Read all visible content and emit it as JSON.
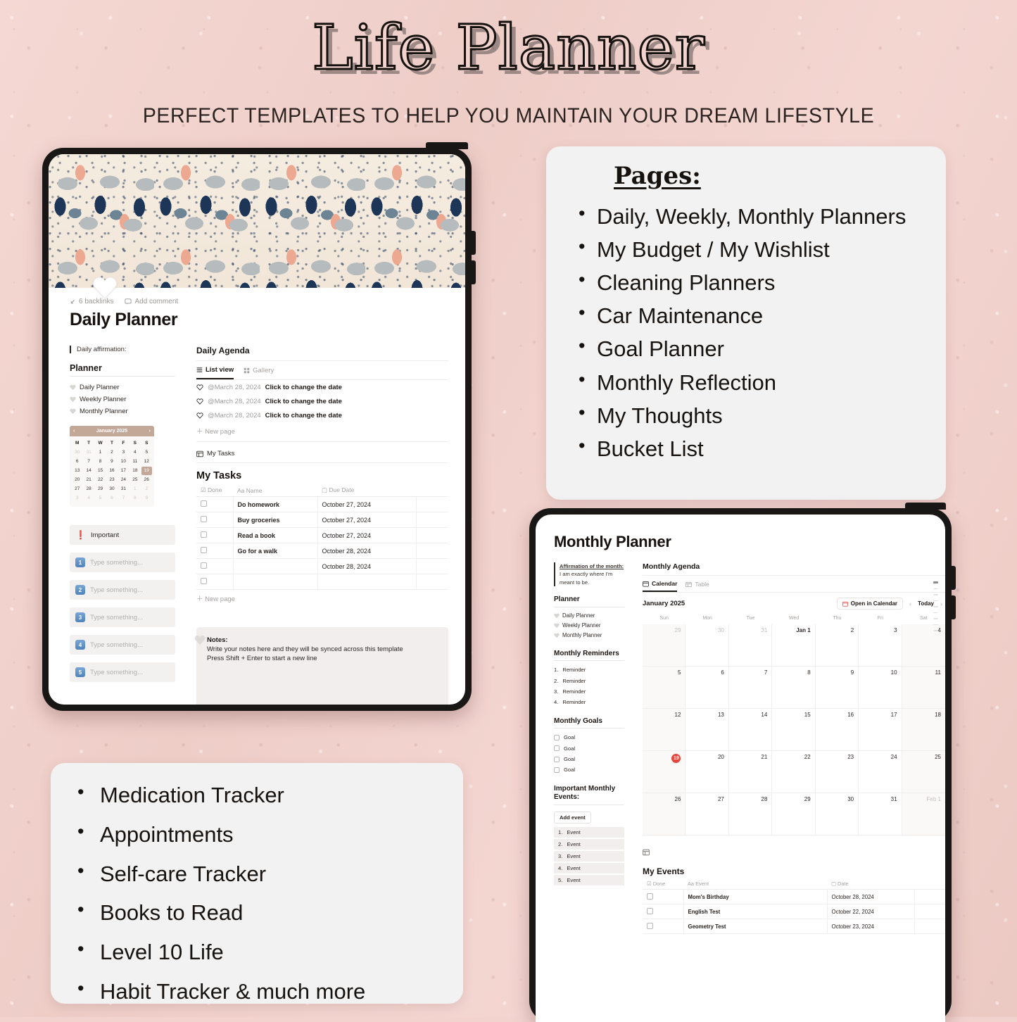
{
  "header": {
    "title": "Life Planner",
    "subtitle": "PERFECT TEMPLATES TO HELP YOU MAINTAIN YOUR DREAM LIFESTYLE"
  },
  "colors": {
    "background_pink": "#f2d3ce",
    "card_gray": "#f2f2f2",
    "tablet_bezel": "#191616",
    "calendar_accent": "#c3a898",
    "today_red": "#e8453c",
    "important_red": "#e03131",
    "number_blue": "#5b8ec4"
  },
  "pages_card": {
    "title": "Pages:",
    "items": [
      "Daily, Weekly, Monthly Planners",
      "My Budget / My Wishlist",
      "Cleaning Planners",
      "Car Maintenance",
      "Goal Planner",
      "Monthly Reflection",
      "My Thoughts",
      "Bucket List"
    ]
  },
  "features_card": {
    "items": [
      "Medication Tracker",
      "Appointments",
      "Self-care Tracker",
      "Books to Read",
      " Level 10 Life",
      " Habit Tracker & much more"
    ]
  },
  "daily_planner": {
    "meta": {
      "backlinks": "6 backlinks",
      "add_comment": "Add comment"
    },
    "title": "Daily Planner",
    "affirmation_label": "Daily affirmation:",
    "planner_heading": "Planner",
    "nav_items": [
      "Daily Planner",
      "Weekly Planner",
      "Monthly Planner"
    ],
    "mini_calendar": {
      "month": "January 2025",
      "dow": [
        "M",
        "T",
        "W",
        "T",
        "F",
        "S",
        "S"
      ],
      "weeks": [
        [
          "30",
          "31",
          "1",
          "2",
          "3",
          "4",
          "5"
        ],
        [
          "6",
          "7",
          "8",
          "9",
          "10",
          "11",
          "12"
        ],
        [
          "13",
          "14",
          "15",
          "16",
          "17",
          "18",
          "19"
        ],
        [
          "20",
          "21",
          "22",
          "23",
          "24",
          "25",
          "26"
        ],
        [
          "27",
          "28",
          "29",
          "30",
          "31",
          "1",
          "2"
        ],
        [
          "3",
          "4",
          "5",
          "6",
          "7",
          "8",
          "9"
        ]
      ],
      "today": "19"
    },
    "important_chip": "Important",
    "type_placeholders": [
      "Type something...",
      "Type something...",
      "Type something...",
      "Type something...",
      "Type something..."
    ],
    "agenda": {
      "heading": "Daily Agenda",
      "tabs": [
        "List view",
        "Gallery"
      ],
      "active_tab": "List view",
      "rows": [
        {
          "date": "@March 28, 2024",
          "cta": "Click to change the date"
        },
        {
          "date": "@March 28, 2024",
          "cta": "Click to change the date"
        },
        {
          "date": "@March 28, 2024",
          "cta": "Click to change the date"
        }
      ],
      "new_page": "New page"
    },
    "tasks_db_label": "My Tasks",
    "tasks": {
      "heading": "My Tasks",
      "columns": [
        "Done",
        "Name",
        "Due Date"
      ],
      "rows": [
        {
          "name": "Do homework",
          "due": "October 27, 2024"
        },
        {
          "name": "Buy groceries",
          "due": "October 27, 2024"
        },
        {
          "name": "Read a book",
          "due": "October 27, 2024"
        },
        {
          "name": "Go for a walk",
          "due": "October 28, 2024"
        },
        {
          "name": "",
          "due": "October 28, 2024"
        },
        {
          "name": "",
          "due": ""
        }
      ],
      "new_page": "New page"
    },
    "notes": {
      "heading": "Notes:",
      "line1": "Write your notes here and they will be synced across this template",
      "line2": "Press Shift + Enter to start a new line"
    }
  },
  "monthly_planner": {
    "title": "Monthly Planner",
    "affirmation_label": "Affirmation of the month:",
    "affirmation_text": " I am exactly where I'm meant to be.",
    "planner_heading": "Planner",
    "nav_items": [
      "Daily Planner",
      "Weekly Planner",
      "Monthly Planner"
    ],
    "reminders_heading": "Monthly Reminders",
    "reminders": [
      "Reminder",
      "Reminder",
      "Reminder",
      "Reminder"
    ],
    "goals_heading": "Monthly Goals",
    "goals": [
      "Goal",
      "Goal",
      "Goal",
      "Goal"
    ],
    "events_heading": "Important Monthly Events:",
    "add_event_button": "Add event",
    "events_list": [
      "Event",
      "Event",
      "Event",
      "Event",
      "Event"
    ],
    "agenda": {
      "heading": "Monthly Agenda",
      "tabs": [
        "Calendar",
        "Table"
      ],
      "active_tab": "Calendar"
    },
    "calendar": {
      "month": "January 2025",
      "open_in_calendar": "Open in Calendar",
      "today_button": "Today",
      "dow": [
        "Sun",
        "Mon",
        "Tue",
        "Wed",
        "Thu",
        "Fri",
        "Sat"
      ],
      "weeks": [
        [
          {
            "t": "29",
            "m": true
          },
          {
            "t": "30",
            "m": true
          },
          {
            "t": "31",
            "m": true
          },
          {
            "t": "Jan 1",
            "b": true
          },
          {
            "t": "2"
          },
          {
            "t": "3"
          },
          {
            "t": "4"
          }
        ],
        [
          {
            "t": "5"
          },
          {
            "t": "6"
          },
          {
            "t": "7"
          },
          {
            "t": "8"
          },
          {
            "t": "9"
          },
          {
            "t": "10"
          },
          {
            "t": "11"
          }
        ],
        [
          {
            "t": "12"
          },
          {
            "t": "13"
          },
          {
            "t": "14"
          },
          {
            "t": "15"
          },
          {
            "t": "16"
          },
          {
            "t": "17"
          },
          {
            "t": "18"
          }
        ],
        [
          {
            "t": "19",
            "today": true
          },
          {
            "t": "20"
          },
          {
            "t": "21"
          },
          {
            "t": "22"
          },
          {
            "t": "23"
          },
          {
            "t": "24"
          },
          {
            "t": "25"
          }
        ],
        [
          {
            "t": "26"
          },
          {
            "t": "27"
          },
          {
            "t": "28"
          },
          {
            "t": "29"
          },
          {
            "t": "30"
          },
          {
            "t": "31"
          },
          {
            "t": "Feb 1",
            "m": true
          }
        ]
      ],
      "today": "19"
    },
    "my_events": {
      "heading": "My Events",
      "columns": [
        "Done",
        "Event",
        "Date"
      ],
      "rows": [
        {
          "name": "Mom's Birthday",
          "date": "October 28, 2024"
        },
        {
          "name": "English Test",
          "date": "October 22, 2024"
        },
        {
          "name": "Geometry Test",
          "date": "October 23, 2024"
        }
      ]
    }
  },
  "icons": {
    "backlink": "arrow-backlink-icon",
    "comment": "comment-icon",
    "heart": "heart-icon",
    "list": "list-view-icon",
    "gallery": "gallery-icon",
    "database": "database-table-icon",
    "calendar": "calendar-icon",
    "checkbox": "checkbox-icon",
    "plus": "plus-icon",
    "chevron_left": "chevron-left-icon",
    "chevron_right": "chevron-right-icon"
  }
}
